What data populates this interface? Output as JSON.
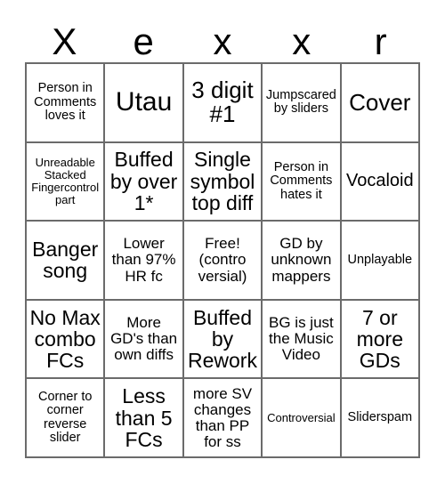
{
  "card": {
    "title_letters": [
      "X",
      "e",
      "x",
      "x",
      "r"
    ],
    "grid_size": 5,
    "colors": {
      "background": "#ffffff",
      "border": "#6b6b6b",
      "text": "#000000"
    },
    "rows": [
      [
        {
          "text": "Person in Comments loves it",
          "size": "xs"
        },
        {
          "text": "Utau",
          "size": "xxl"
        },
        {
          "text": "3 digit #1",
          "size": "xl"
        },
        {
          "text": "Jumpscared by sliders",
          "size": "xs"
        },
        {
          "text": "Cover",
          "size": "xl"
        }
      ],
      [
        {
          "text": "Unreadable Stacked Fingercontrol part",
          "size": "xxs"
        },
        {
          "text": "Buffed by over 1*",
          "size": "l"
        },
        {
          "text": "Single symbol top diff",
          "size": "l"
        },
        {
          "text": "Person in Comments hates it",
          "size": "xs"
        },
        {
          "text": "Vocaloid",
          "size": "m"
        }
      ],
      [
        {
          "text": "Banger song",
          "size": "l"
        },
        {
          "text": "Lower than 97% HR fc",
          "size": "s"
        },
        {
          "text": "Free! (contro versial)",
          "size": "s"
        },
        {
          "text": "GD by unknown mappers",
          "size": "s"
        },
        {
          "text": "Unplayable",
          "size": "xs"
        }
      ],
      [
        {
          "text": "No Max combo FCs",
          "size": "l"
        },
        {
          "text": "More GD's than own diffs",
          "size": "s"
        },
        {
          "text": "Buffed by Rework",
          "size": "l"
        },
        {
          "text": "BG is just the Music Video",
          "size": "s"
        },
        {
          "text": "7 or more GDs",
          "size": "l"
        }
      ],
      [
        {
          "text": "Corner to corner reverse slider",
          "size": "xs"
        },
        {
          "text": "Less than 5 FCs",
          "size": "l"
        },
        {
          "text": "more SV changes than PP for ss",
          "size": "s"
        },
        {
          "text": "Controversial",
          "size": "xxs"
        },
        {
          "text": "Sliderspam",
          "size": "xs"
        }
      ]
    ]
  }
}
